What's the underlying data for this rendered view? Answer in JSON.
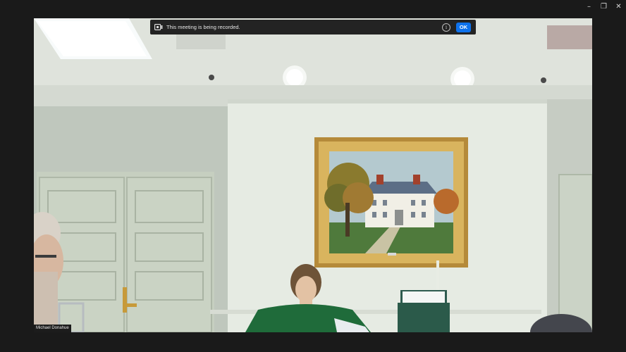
{
  "window_controls": {
    "minimize": "–",
    "restore": "❐",
    "close": "✕"
  },
  "banner": {
    "icon": "recording-icon",
    "message": "This meeting is being recorded.",
    "info_icon": "info-icon",
    "info_glyph": "i",
    "ok_label": "OK"
  },
  "participant": {
    "name": "Michael Donahue"
  },
  "colors": {
    "banner_bg": "#232323",
    "ok_button": "#0e72ed",
    "window_bg": "#1a1a1a"
  }
}
